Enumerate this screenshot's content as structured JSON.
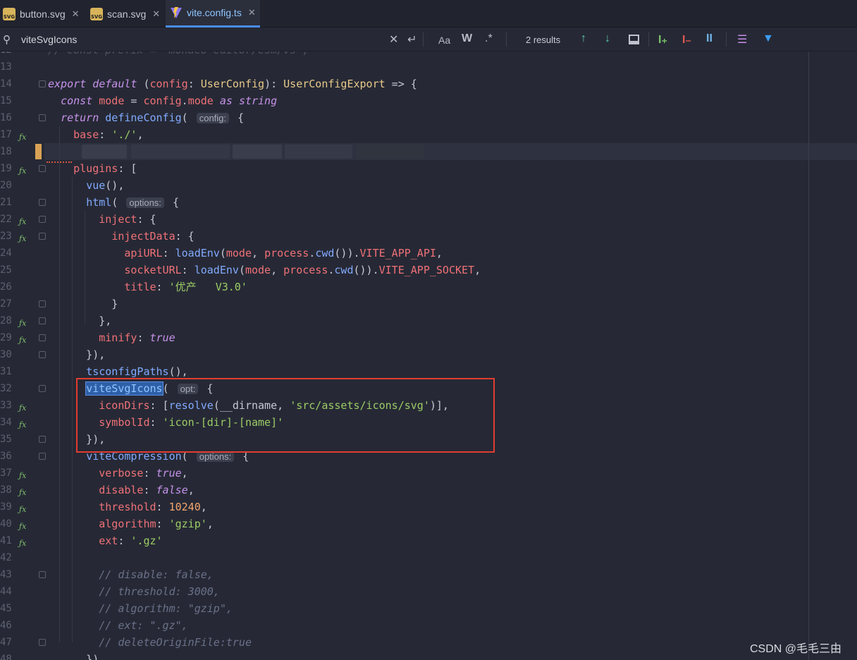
{
  "tabs": [
    {
      "label": "button.svg",
      "icon": "svg-file-icon",
      "active": false
    },
    {
      "label": "scan.svg",
      "icon": "svg-file-icon",
      "active": false
    },
    {
      "label": "vite.config.ts",
      "icon": "vite-icon",
      "active": true
    }
  ],
  "find": {
    "query": "viteSvgIcons",
    "results": "2 results",
    "match_case": "Aa",
    "whole_word": "W",
    "regex": ".*"
  },
  "file_badge": "SVG",
  "watermark": "CSDN @毛毛三由",
  "lines": [
    {
      "n": "12",
      "code": "// const prefix = `monaco-editor/esm/vs`;"
    },
    {
      "n": "13",
      "code": ""
    },
    {
      "n": "14",
      "code": "export default (config: UserConfig): UserConfigExport => {"
    },
    {
      "n": "15",
      "code": "  const mode = config.mode as string"
    },
    {
      "n": "16",
      "code": "  return defineConfig( config: {"
    },
    {
      "n": "17",
      "code": "    base: './',"
    },
    {
      "n": "18",
      "code": ""
    },
    {
      "n": "19",
      "code": "    plugins: ["
    },
    {
      "n": "20",
      "code": "      vue(),"
    },
    {
      "n": "21",
      "code": "      html( options: {"
    },
    {
      "n": "22",
      "code": "        inject: {"
    },
    {
      "n": "23",
      "code": "          injectData: {"
    },
    {
      "n": "24",
      "code": "            apiURL: loadEnv(mode, process.cwd()).VITE_APP_API,"
    },
    {
      "n": "25",
      "code": "            socketURL: loadEnv(mode, process.cwd()).VITE_APP_SOCKET,"
    },
    {
      "n": "26",
      "code": "            title: '优产   V3.0'"
    },
    {
      "n": "27",
      "code": "          }"
    },
    {
      "n": "28",
      "code": "        },"
    },
    {
      "n": "29",
      "code": "        minify: true"
    },
    {
      "n": "30",
      "code": "      }),"
    },
    {
      "n": "31",
      "code": "      tsconfigPaths(),"
    },
    {
      "n": "32",
      "code": "      viteSvgIcons( opt: {"
    },
    {
      "n": "33",
      "code": "        iconDirs: [resolve(__dirname, 'src/assets/icons/svg')],"
    },
    {
      "n": "34",
      "code": "        symbolId: 'icon-[dir]-[name]'"
    },
    {
      "n": "35",
      "code": "      }),"
    },
    {
      "n": "36",
      "code": "      viteCompression( options: {"
    },
    {
      "n": "37",
      "code": "        verbose: true,"
    },
    {
      "n": "38",
      "code": "        disable: false,"
    },
    {
      "n": "39",
      "code": "        threshold: 10240,"
    },
    {
      "n": "40",
      "code": "        algorithm: 'gzip',"
    },
    {
      "n": "41",
      "code": "        ext: '.gz'"
    },
    {
      "n": "42",
      "code": ""
    },
    {
      "n": "43",
      "code": "        // disable: false,"
    },
    {
      "n": "44",
      "code": "        // threshold: 3000,"
    },
    {
      "n": "45",
      "code": "        // algorithm: \"gzip\","
    },
    {
      "n": "46",
      "code": "        // ext: \".gz\","
    },
    {
      "n": "47",
      "code": "        // deleteOriginFile:true"
    },
    {
      "n": "48",
      "code": "      }),"
    }
  ],
  "colors": {
    "accent": "#4a8cf0",
    "highlight_box": "#e23c31",
    "background": "#262935"
  }
}
